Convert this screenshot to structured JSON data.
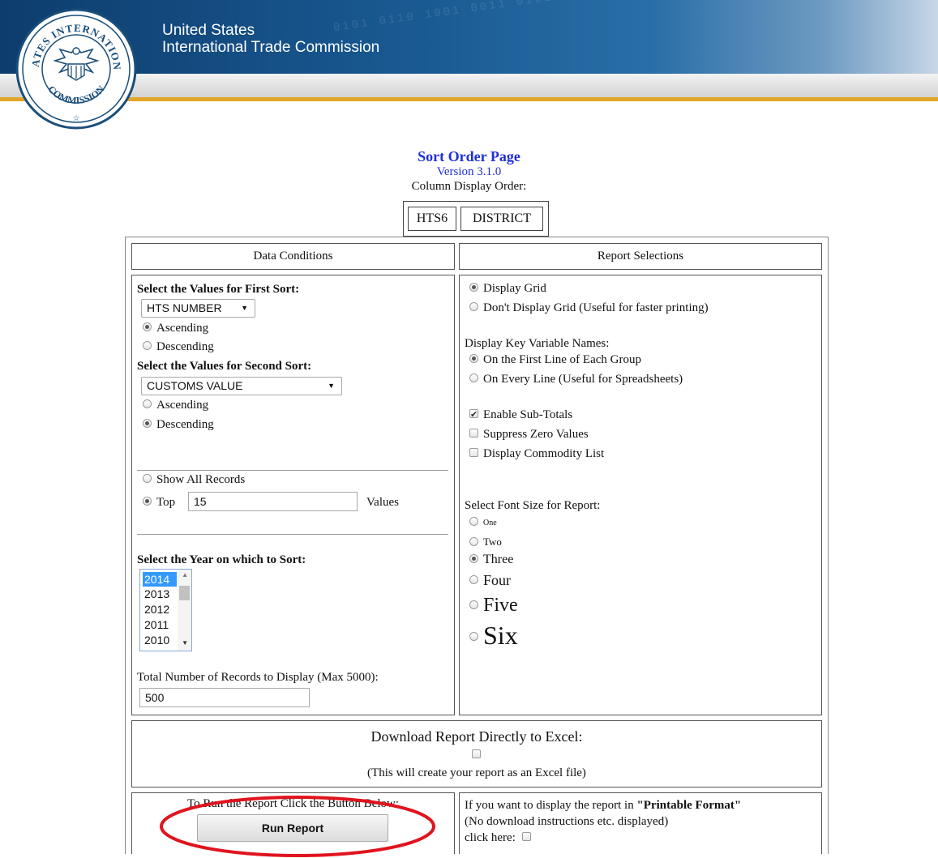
{
  "header": {
    "org_line1": "United States",
    "org_line2": "International Trade Commission",
    "seal_text_top": "UNITED STATES INTERNATIONAL TRADE",
    "seal_text_bottom": "COMMISSION",
    "colors": {
      "banner_blue": "#1a5a93",
      "gold_stripe": "#e3a62a",
      "title_blue": "#1f2fd6",
      "annotation_red": "#e0141e"
    }
  },
  "page": {
    "title": "Sort Order Page",
    "version": "Version 3.1.0",
    "column_display_order_label": "Column Display Order:",
    "column_display_order": [
      "HTS6",
      "DISTRICT"
    ]
  },
  "data_conditions": {
    "header": "Data Conditions",
    "first_sort": {
      "label": "Select the Values for First Sort:",
      "value": "HTS NUMBER",
      "options": [
        {
          "label": "Ascending",
          "selected": true
        },
        {
          "label": "Descending",
          "selected": false
        }
      ]
    },
    "second_sort": {
      "label": "Select the Values for Second Sort:",
      "value": "CUSTOMS VALUE",
      "options": [
        {
          "label": "Ascending",
          "selected": false
        },
        {
          "label": "Descending",
          "selected": true
        }
      ]
    },
    "records": {
      "show_all_label": "Show All Records",
      "top_label": "Top",
      "top_value": "15",
      "values_label": "Values",
      "selected": "top"
    },
    "year": {
      "label": "Select the Year on which to Sort:",
      "options": [
        "2014",
        "2013",
        "2012",
        "2011",
        "2010"
      ],
      "selected": "2014"
    },
    "total_records": {
      "label": "Total Number of Records to Display (Max 5000):",
      "value": "500"
    }
  },
  "report_selections": {
    "header": "Report Selections",
    "grid": [
      {
        "label": "Display Grid",
        "selected": true
      },
      {
        "label": "Don't Display Grid (Useful for faster printing)",
        "selected": false
      }
    ],
    "key_names_label": "Display Key Variable Names:",
    "key_names": [
      {
        "label": "On the First Line of Each Group",
        "selected": true
      },
      {
        "label": "On Every Line (Useful for Spreadsheets)",
        "selected": false
      }
    ],
    "checkboxes": [
      {
        "label": "Enable Sub-Totals",
        "checked": true
      },
      {
        "label": "Suppress Zero Values",
        "checked": false
      },
      {
        "label": "Display Commodity List",
        "checked": false
      }
    ],
    "font_size_label": "Select Font Size for Report:",
    "font_sizes": [
      {
        "label": "One",
        "selected": false
      },
      {
        "label": "Two",
        "selected": false
      },
      {
        "label": "Three",
        "selected": true
      },
      {
        "label": "Four",
        "selected": false
      },
      {
        "label": "Five",
        "selected": false
      },
      {
        "label": "Six",
        "selected": false
      }
    ]
  },
  "excel": {
    "title": "Download Report Directly to Excel:",
    "checked": false,
    "note": "(This will create your report as an Excel file)"
  },
  "run": {
    "instruction": "To Run the Report Click the Button Below:",
    "button_label": "Run Report"
  },
  "printable": {
    "line1_prefix": "If you want to display the report in ",
    "line1_bold": "\"Printable Format\"",
    "line2": "(No download instructions etc. displayed)",
    "line3": "click here:",
    "checked": false
  }
}
